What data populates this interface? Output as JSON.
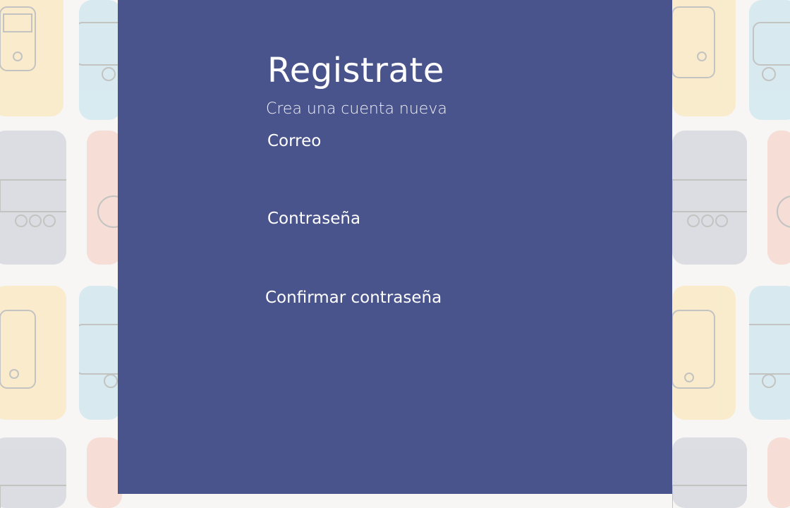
{
  "form": {
    "title": "Registrate",
    "subtitle": "Crea una cuenta nueva",
    "email_label": "Correo",
    "email_value": "",
    "password_label": "Contraseña",
    "password_value": "",
    "confirm_label": "Confirmar contraseña",
    "confirm_value": ""
  },
  "colors": {
    "panel": "#4a548c",
    "text": "#ffffff",
    "tile_yellow": "#fbe3ad",
    "tile_blue": "#bfe1ee",
    "tile_gray": "#c7cad6",
    "tile_red": "#f6c9bd"
  },
  "background_icons": [
    "bus-icon",
    "train-icon",
    "wheel-icon"
  ]
}
